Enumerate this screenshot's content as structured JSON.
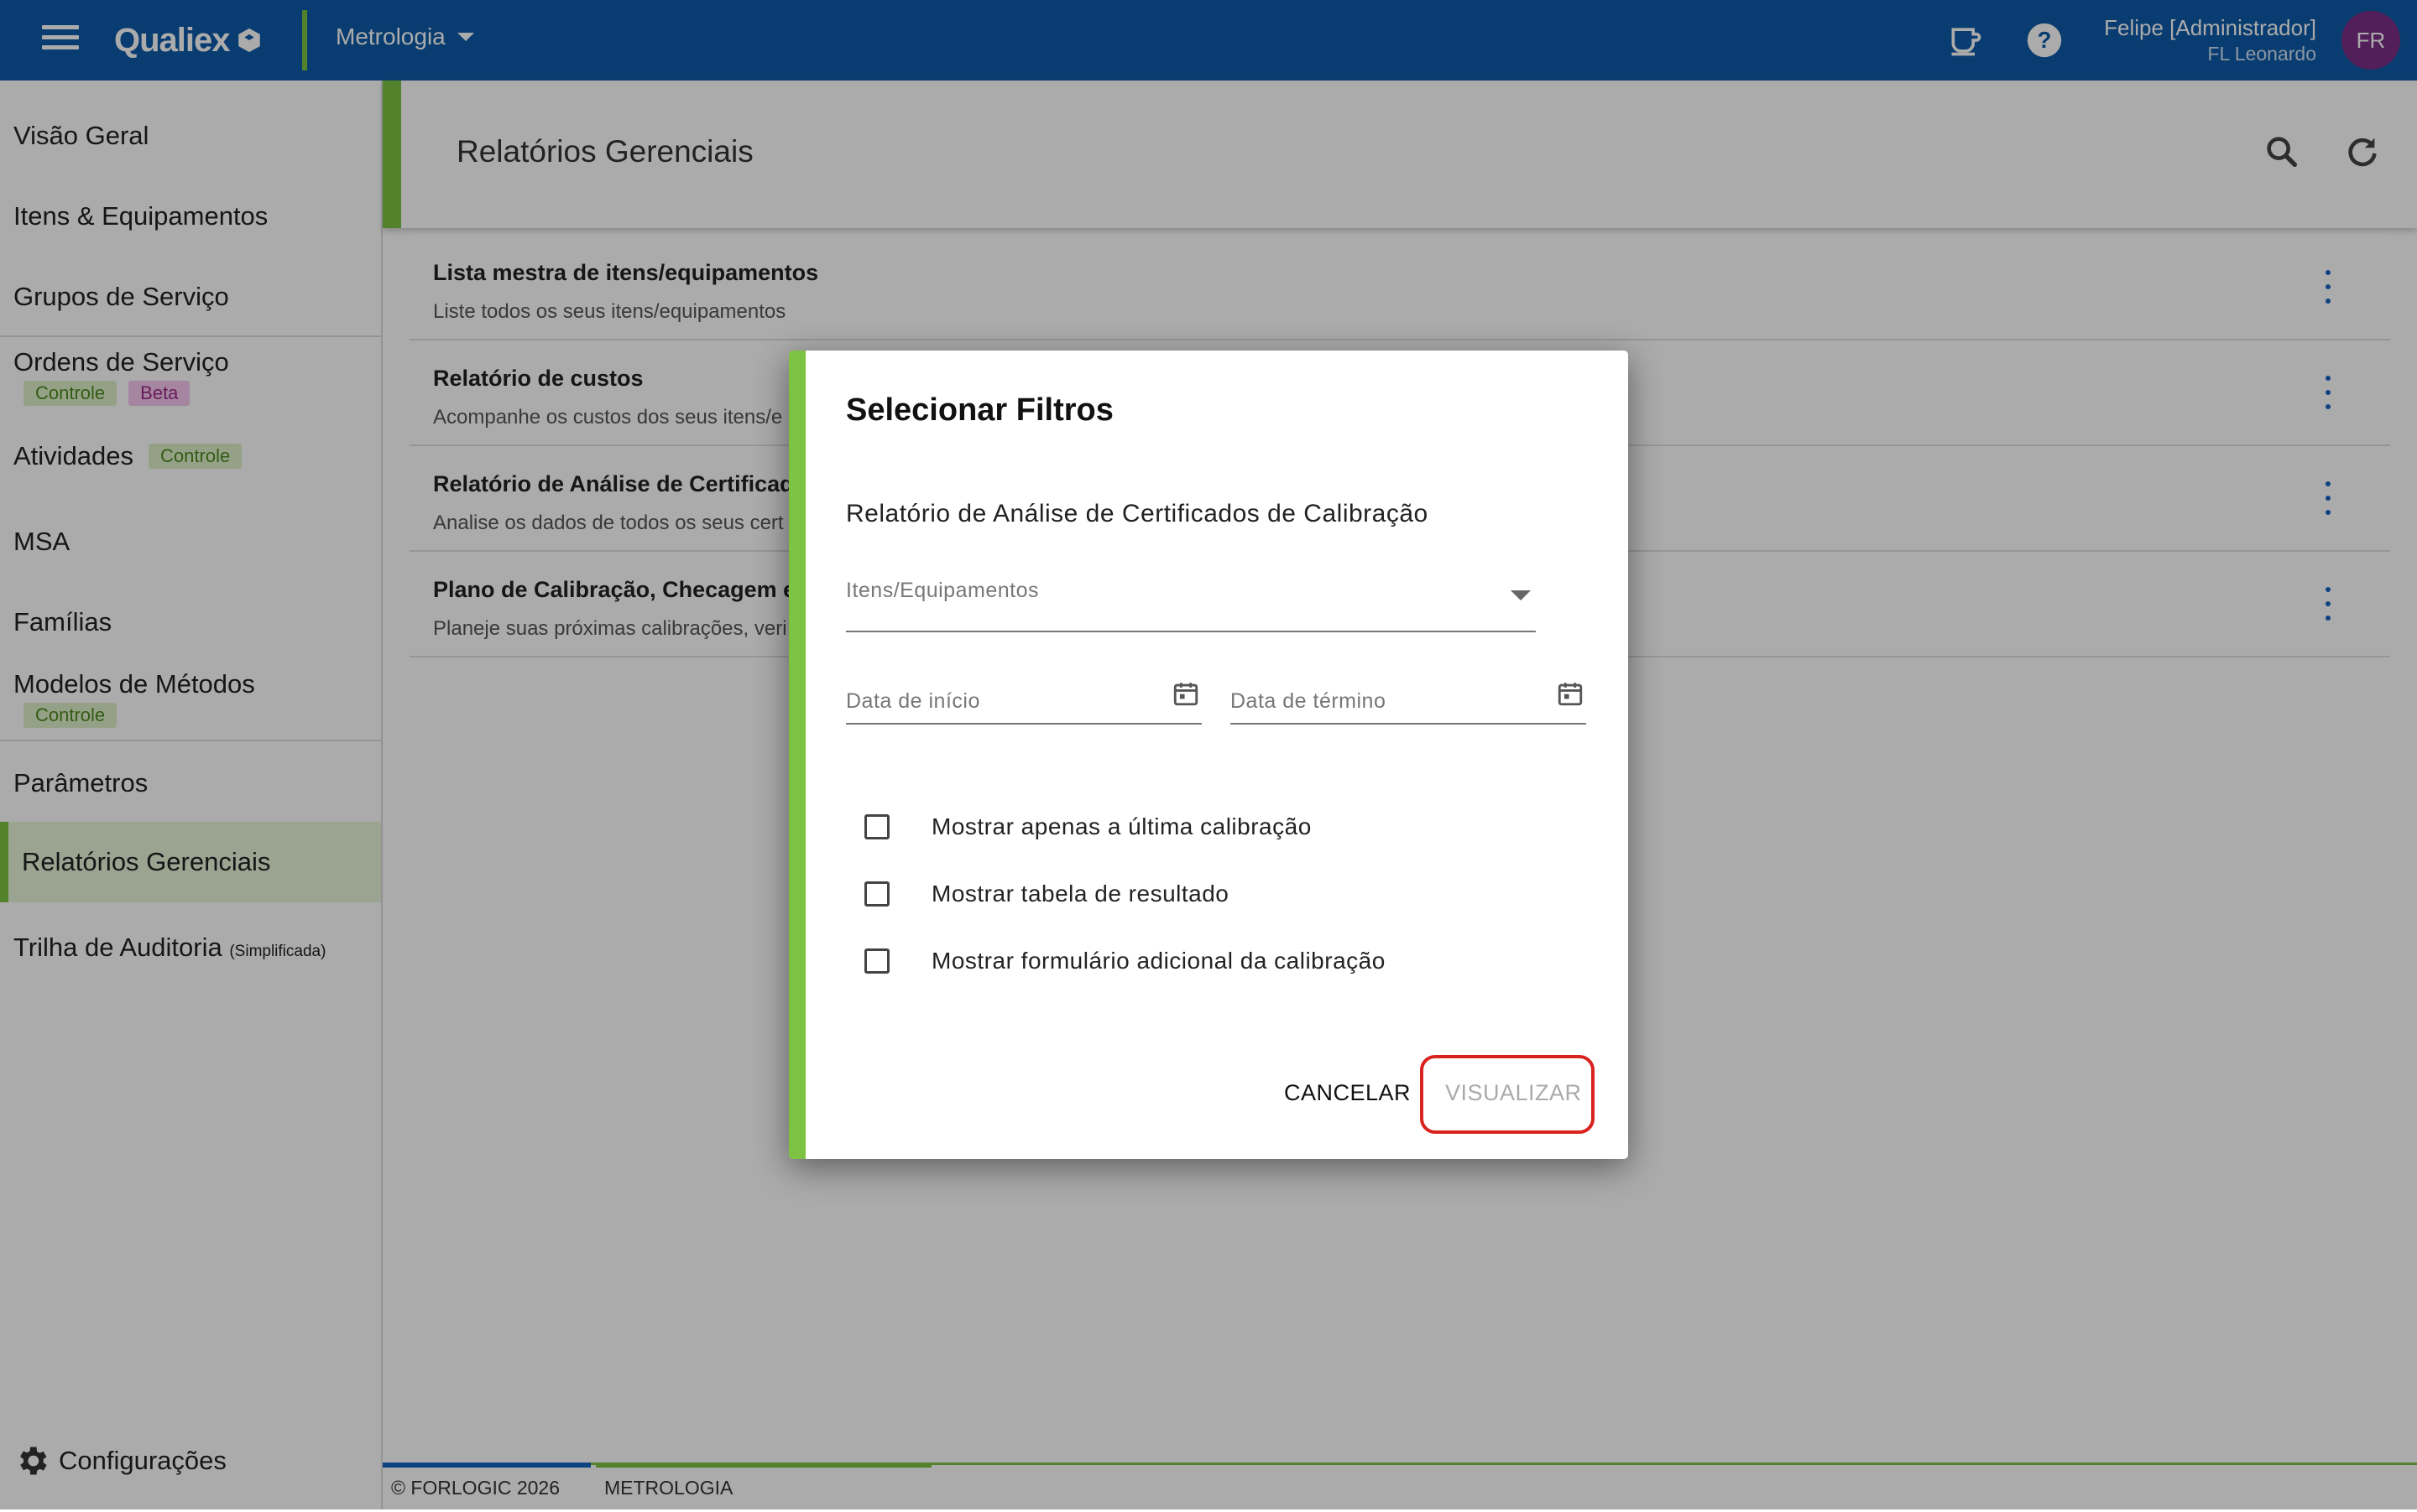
{
  "topbar": {
    "logo": "Qualiex",
    "module": "Metrologia",
    "user_name": "Felipe [Administrador]",
    "user_sub": "FL Leonardo",
    "avatar_initials": "FR"
  },
  "sidebar": {
    "items": [
      {
        "label": "Visão Geral"
      },
      {
        "label": "Itens & Equipamentos"
      },
      {
        "label": "Grupos de Serviço"
      },
      {
        "label": "Ordens de Serviço",
        "badges": [
          "Controle",
          "Beta"
        ]
      },
      {
        "label": "Atividades",
        "badges": [
          "Controle"
        ]
      },
      {
        "label": "MSA"
      },
      {
        "label": "Famílias"
      },
      {
        "label": "Modelos de Métodos",
        "badges": [
          "Controle"
        ]
      },
      {
        "label": "Parâmetros"
      },
      {
        "label": "Relatórios Gerenciais"
      },
      {
        "label": "Trilha de Auditoria",
        "note": "(Simplificada)"
      }
    ],
    "settings_label": "Configurações"
  },
  "main": {
    "title": "Relatórios Gerenciais",
    "reports": [
      {
        "title": "Lista mestra de itens/equipamentos",
        "desc": "Liste todos os seus itens/equipamentos"
      },
      {
        "title": "Relatório de custos",
        "desc": "Acompanhe os custos dos seus itens/e"
      },
      {
        "title": "Relatório de Análise de Certificado",
        "desc": "Analise os dados de todos os seus cert"
      },
      {
        "title": "Plano de Calibração, Checagem e",
        "desc": "Planeje suas próximas calibrações, veri"
      }
    ]
  },
  "footer": {
    "copyright": "© FORLOGIC 2026",
    "module": "METROLOGIA"
  },
  "dialog": {
    "title": "Selecionar Filtros",
    "subtitle": "Relatório de Análise de Certificados de Calibração",
    "items_placeholder": "Itens/Equipamentos",
    "start_date_label": "Data de início",
    "end_date_label": "Data de término",
    "checkboxes": [
      {
        "label": "Mostrar apenas a última calibração",
        "checked": false
      },
      {
        "label": "Mostrar tabela de resultado",
        "checked": false
      },
      {
        "label": "Mostrar formulário adicional da calibração",
        "checked": false
      }
    ],
    "cancel_label": "CANCELAR",
    "view_label": "VISUALIZAR"
  },
  "colors": {
    "topbar": "#0e5aa7",
    "accent_green": "#7dc243",
    "avatar": "#7b2f86",
    "highlight_red": "#d9231f"
  }
}
